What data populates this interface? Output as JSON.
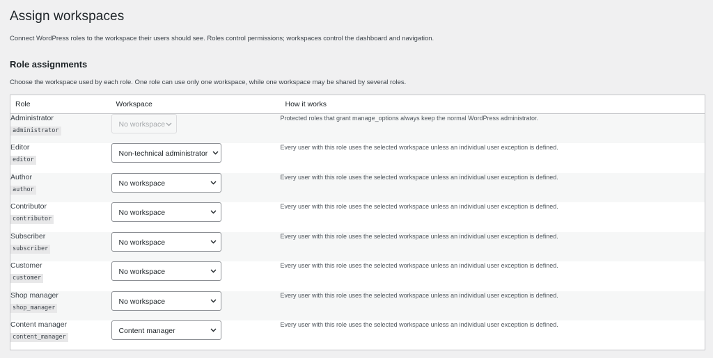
{
  "page": {
    "title": "Assign workspaces",
    "intro": "Connect WordPress roles to the workspace their users should see. Roles control permissions; workspaces control the dashboard and navigation."
  },
  "section": {
    "title": "Role assignments",
    "description": "Choose the workspace used by each role. One role can use only one workspace, while one workspace may be shared by several roles."
  },
  "table": {
    "headers": [
      "Role",
      "Workspace",
      "How it works"
    ],
    "rows": [
      {
        "name": "Administrator",
        "slug": "administrator",
        "workspace": "No workspace",
        "disabled": true,
        "how": "Protected roles that grant manage_options always keep the normal WordPress administrator."
      },
      {
        "name": "Editor",
        "slug": "editor",
        "workspace": "Non-technical administrator",
        "disabled": false,
        "how": "Every user with this role uses the selected workspace unless an individual user exception is defined."
      },
      {
        "name": "Author",
        "slug": "author",
        "workspace": "No workspace",
        "disabled": false,
        "how": "Every user with this role uses the selected workspace unless an individual user exception is defined."
      },
      {
        "name": "Contributor",
        "slug": "contributor",
        "workspace": "No workspace",
        "disabled": false,
        "how": "Every user with this role uses the selected workspace unless an individual user exception is defined."
      },
      {
        "name": "Subscriber",
        "slug": "subscriber",
        "workspace": "No workspace",
        "disabled": false,
        "how": "Every user with this role uses the selected workspace unless an individual user exception is defined."
      },
      {
        "name": "Customer",
        "slug": "customer",
        "workspace": "No workspace",
        "disabled": false,
        "how": "Every user with this role uses the selected workspace unless an individual user exception is defined."
      },
      {
        "name": "Shop manager",
        "slug": "shop_manager",
        "workspace": "No workspace",
        "disabled": false,
        "how": "Every user with this role uses the selected workspace unless an individual user exception is defined."
      },
      {
        "name": "Content manager",
        "slug": "content_manager",
        "workspace": "Content manager",
        "disabled": false,
        "how": "Every user with this role uses the selected workspace unless an individual user exception is defined."
      }
    ]
  },
  "icons": {
    "select_arrow": "chevron-down-icon"
  },
  "colors": {
    "background": "#f0f0f1",
    "table_bg": "#ffffff",
    "stripe": "#f6f7f7",
    "border": "#c3c4c7",
    "text": "#1d2327"
  }
}
